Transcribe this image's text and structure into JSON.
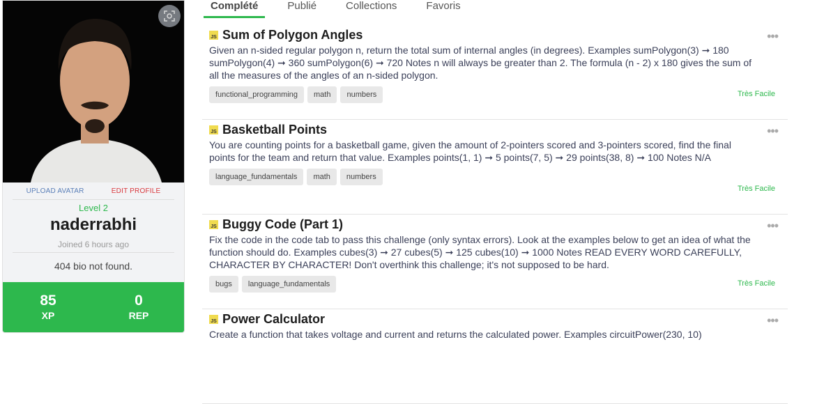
{
  "profile": {
    "upload_avatar": "UPLOAD AVATAR",
    "edit_profile": "EDIT PROFILE",
    "level": "Level 2",
    "username": "naderrabhi",
    "joined": "Joined 6 hours ago",
    "bio": "404 bio not found.",
    "xp": "85",
    "xp_label": "XP",
    "rep": "0",
    "rep_label": "REP"
  },
  "tabs": [
    {
      "label": "Complété"
    },
    {
      "label": "Publié"
    },
    {
      "label": "Collections"
    },
    {
      "label": "Favoris"
    }
  ],
  "challenges": [
    {
      "lang": "JS",
      "title": "Sum of Polygon Angles",
      "desc": "Given an n-sided regular polygon n, return the total sum of internal angles (in degrees). Examples sumPolygon(3) ➞ 180 sumPolygon(4) ➞ 360 sumPolygon(6) ➞ 720 Notes n will always be greater than 2. The formula (n - 2) x 180 gives the sum of all the measures of the angles of an n-sided polygon.",
      "tags": [
        "functional_programming",
        "math",
        "numbers"
      ],
      "difficulty": "Très Facile"
    },
    {
      "lang": "JS",
      "title": "Basketball Points",
      "desc": "You are counting points for a basketball game, given the amount of 2-pointers scored and 3-pointers scored, find the final points for the team and return that value. Examples points(1, 1) ➞ 5 points(7, 5) ➞ 29 points(38, 8) ➞ 100 Notes N/A",
      "tags": [
        "language_fundamentals",
        "math",
        "numbers"
      ],
      "difficulty": "Très Facile"
    },
    {
      "lang": "JS",
      "title": "Buggy Code (Part 1)",
      "desc": "Fix the code in the code tab to pass this challenge (only syntax errors). Look at the examples below to get an idea of what the function should do. Examples cubes(3) ➞ 27 cubes(5) ➞ 125 cubes(10) ➞ 1000 Notes READ EVERY WORD CAREFULLY, CHARACTER BY CHARACTER! Don't overthink this challenge; it's not supposed to be hard.",
      "tags": [
        "bugs",
        "language_fundamentals"
      ],
      "difficulty": "Très Facile"
    },
    {
      "lang": "JS",
      "title": "Power Calculator",
      "desc": "Create a function that takes voltage and current and returns the calculated power. Examples circuitPower(230, 10)",
      "tags": [],
      "difficulty": ""
    }
  ],
  "more_glyph": "•••"
}
